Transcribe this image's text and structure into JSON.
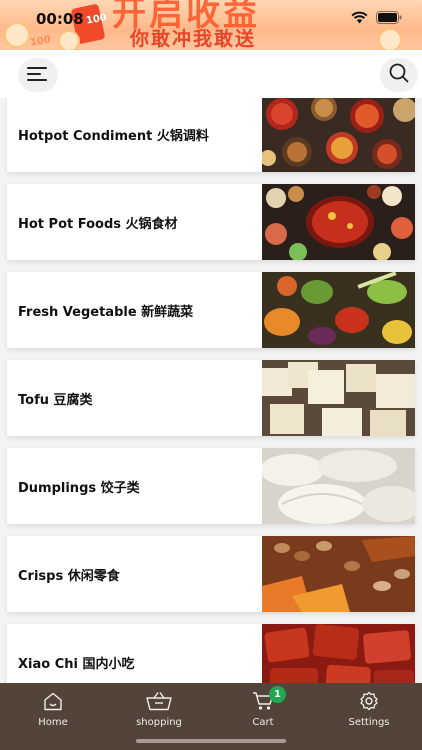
{
  "status_bar": {
    "time": "00:08"
  },
  "banner": {
    "headline": "开启收益",
    "slogan": "你敢冲我敢送",
    "coin_text": "100"
  },
  "categories": [
    {
      "label": "Hotpot Condiment 火锅调料",
      "image": "spice-bowls"
    },
    {
      "label": "Hot Pot Foods 火锅食材",
      "image": "hotpot-spread"
    },
    {
      "label": "Fresh Vegetable 新鲜蔬菜",
      "image": "vegetables"
    },
    {
      "label": "Tofu 豆腐类",
      "image": "tofu-cubes"
    },
    {
      "label": "Dumplings 饺子类",
      "image": "dumplings"
    },
    {
      "label": "Crisps 休闲零食",
      "image": "peanuts-crisps"
    },
    {
      "label": "Xiao Chi 国内小吃",
      "image": "dried-meat"
    }
  ],
  "tabbar": {
    "items": [
      {
        "label": "Home",
        "icon": "home-icon"
      },
      {
        "label": "shopping",
        "icon": "basket-icon"
      },
      {
        "label": "Cart",
        "icon": "cart-icon"
      },
      {
        "label": "Settings",
        "icon": "gear-icon"
      }
    ],
    "cart_badge": "1"
  },
  "colors": {
    "tabbar_bg": "#53443a",
    "badge": "#1fa84f",
    "banner_accent": "#e8452a"
  }
}
